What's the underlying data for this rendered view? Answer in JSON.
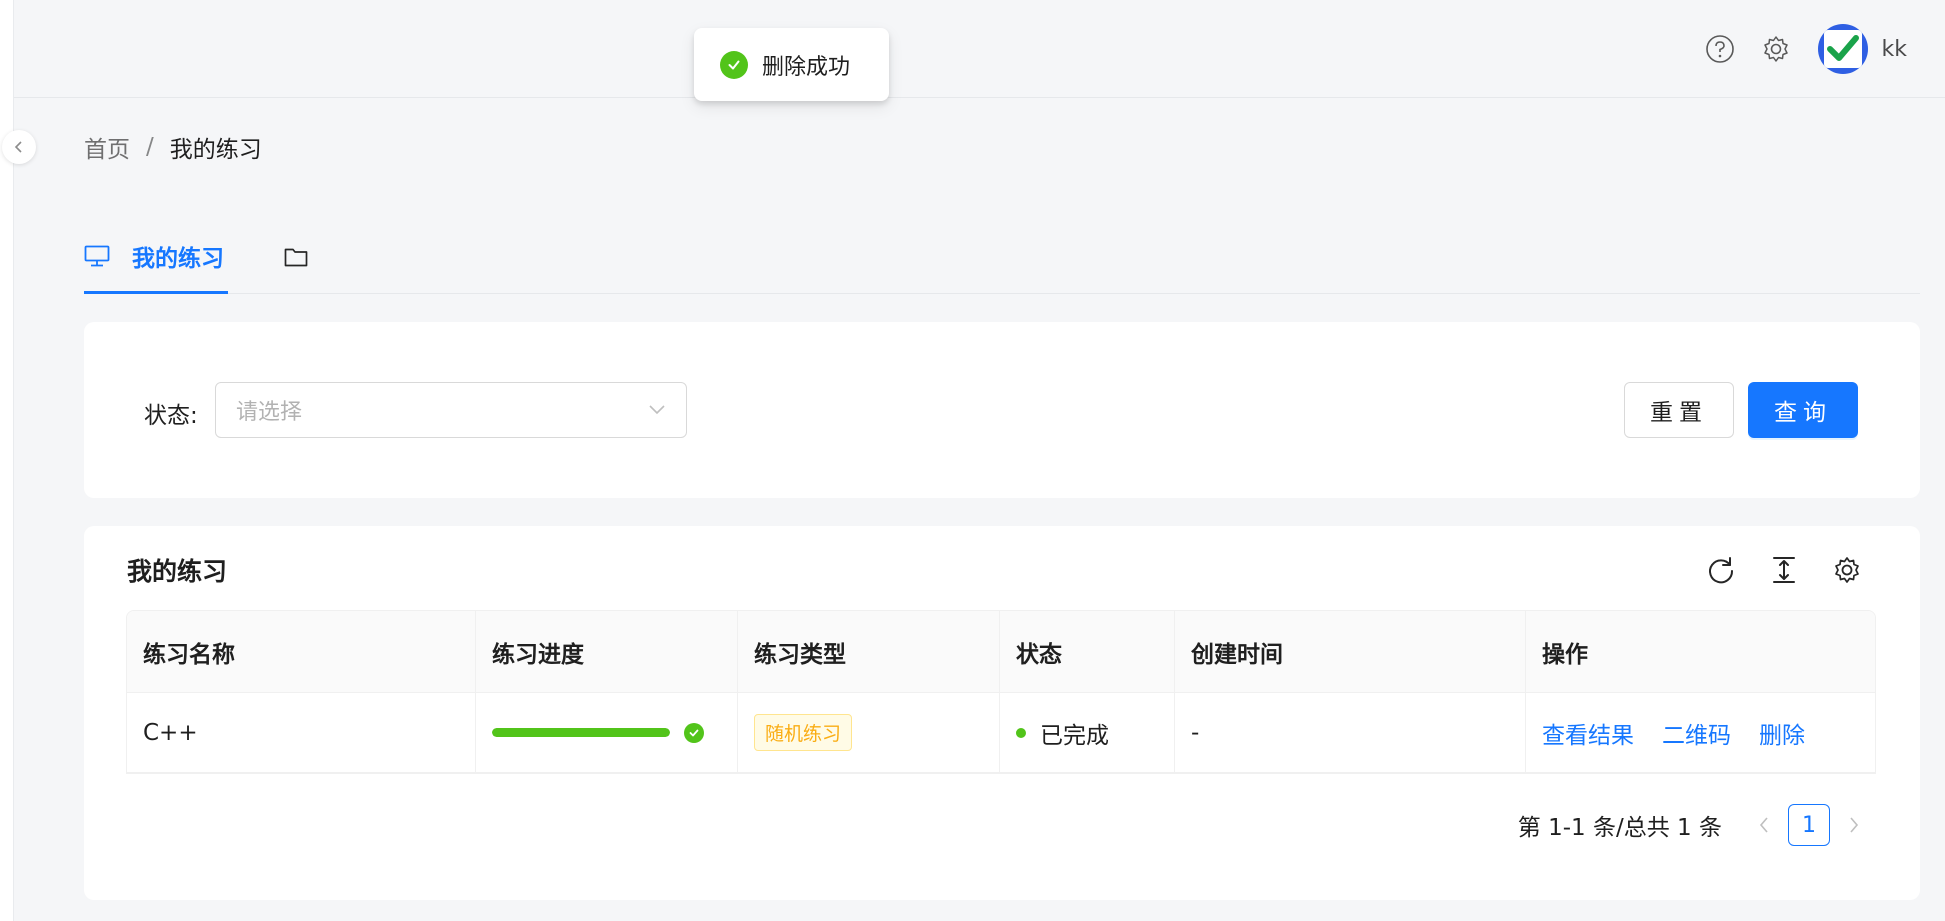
{
  "header": {
    "username": "kk",
    "icons": [
      "question-icon",
      "gear-icon"
    ]
  },
  "toast": {
    "message": "删除成功"
  },
  "breadcrumb": {
    "home": "首页",
    "separator": "/",
    "current": "我的练习"
  },
  "tabs": {
    "active_label": "我的练习"
  },
  "filter": {
    "status_label": "状态:",
    "status_placeholder": "请选择",
    "reset_label": "重置",
    "query_label": "查询"
  },
  "table": {
    "title": "我的练习",
    "columns": [
      "练习名称",
      "练习进度",
      "练习类型",
      "状态",
      "创建时间",
      "操作"
    ],
    "rows": [
      {
        "name": "C++",
        "progress": 1.0,
        "type": "随机练习",
        "status": "已完成",
        "created": "-",
        "actions": [
          "查看结果",
          "二维码",
          "删除"
        ]
      }
    ]
  },
  "pagination": {
    "summary": "第 1-1 条/总共 1 条",
    "current_page": "1"
  },
  "colors": {
    "primary": "#1677ff",
    "success": "#52c41a",
    "warning": "#faad14"
  }
}
